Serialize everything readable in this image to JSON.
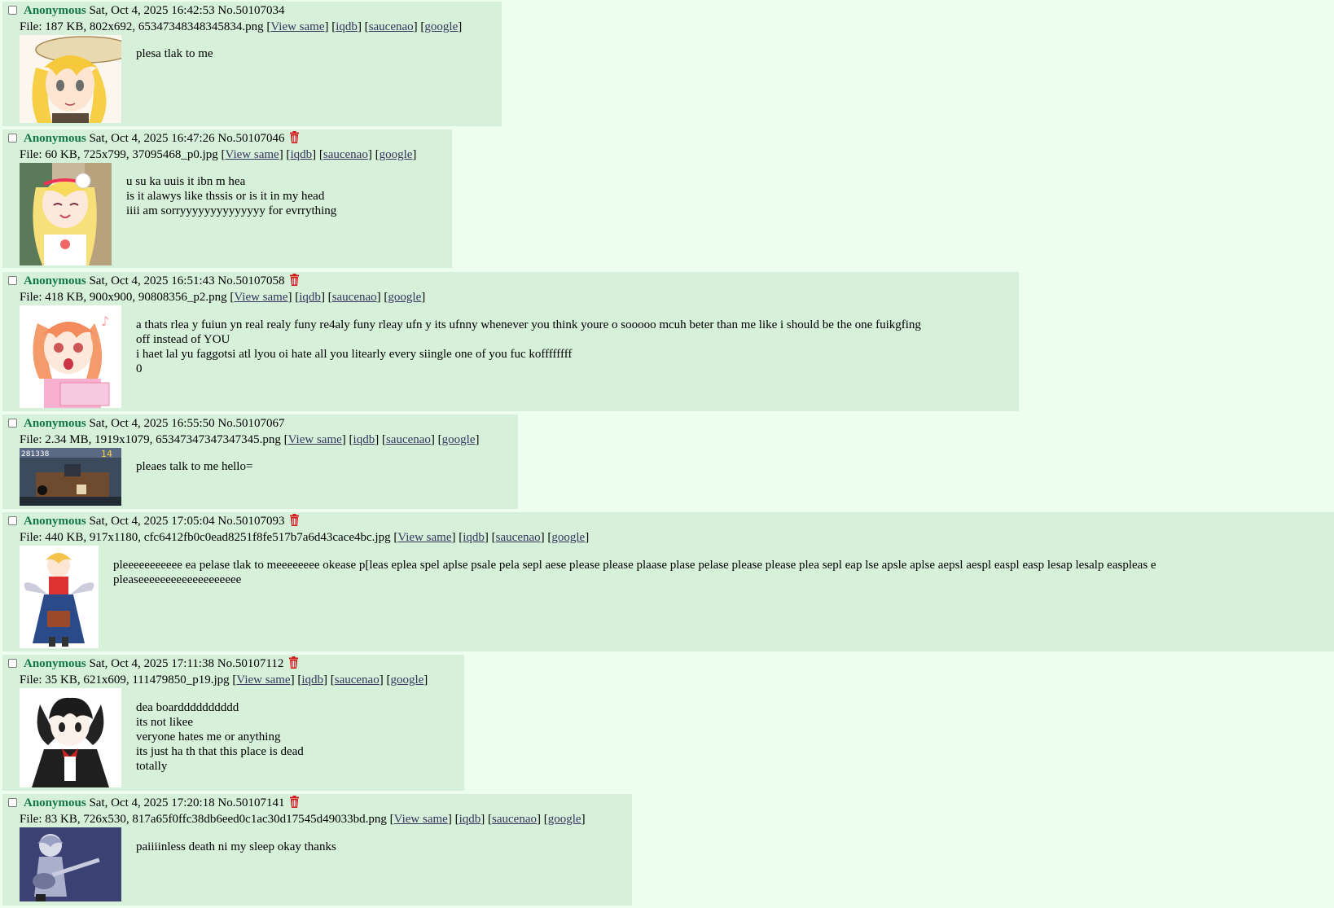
{
  "colors": {
    "page_background": "#eefeee",
    "post_background": "#d6f0da",
    "name": "#117743",
    "link": "#34345c",
    "delete_icon": "#d11b1b"
  },
  "icons": {
    "checkbox": "select-checkbox",
    "delete": "trash-icon"
  },
  "links": {
    "view_same": "View same",
    "iqdb": "iqdb",
    "saucenao": "saucenao",
    "google": "google"
  },
  "posts": [
    {
      "name": "Anonymous",
      "datetime": "Sat, Oct 4, 2025 16:42:53",
      "number": "No.50107034",
      "has_delete": false,
      "file_prefix": "File: 187 KB, 802x692, 65347348348345834.png",
      "body": "plesa tlak to me"
    },
    {
      "name": "Anonymous",
      "datetime": "Sat, Oct 4, 2025 16:47:26",
      "number": "No.50107046",
      "has_delete": true,
      "file_prefix": "File: 60 KB, 725x799, 37095468_p0.jpg",
      "body": "u su ka uuis it ibn m hea\nis it alawys like thssis or is it in my head\niiii am sorryyyyyyyyyyyyyy for evrrything"
    },
    {
      "name": "Anonymous",
      "datetime": "Sat, Oct 4, 2025 16:51:43",
      "number": "No.50107058",
      "has_delete": true,
      "file_prefix": "File: 418 KB, 900x900, 90808356_p2.png",
      "body": "a thats rlea y fuiun yn real realy funy re4aly funy rleay ufn y its ufnny whenever you think youre o sooooo mcuh beter than me like i should be the one fuikgfing\noff instead of YOU\ni haet lal yu faggotsi atl lyou oi hate all you litearly every siingle one of you fuc koffffffff\n0"
    },
    {
      "name": "Anonymous",
      "datetime": "Sat, Oct 4, 2025 16:55:50",
      "number": "No.50107067",
      "has_delete": false,
      "file_prefix": "File: 2.34 MB, 1919x1079, 65347347347347345.png",
      "body": "pleaes talk to me hello="
    },
    {
      "name": "Anonymous",
      "datetime": "Sat, Oct 4, 2025 17:05:04",
      "number": "No.50107093",
      "has_delete": true,
      "file_prefix": "File: 440 KB, 917x1180, cfc6412fb0c0ead8251f8fe517b7a6d43cace4bc.jpg",
      "body": "pleeeeeeeeeee ea pelase tlak to meeeeeeee okease p[leas eplea spel aplse psale pela sepl aese please please plaase plase pelase please please plea sepl eap lse apsle aplse aepsl aespl easpl easp lesap lesalp easpleas e\npleaseeeeeeeeeeeeeeeeeee"
    },
    {
      "name": "Anonymous",
      "datetime": "Sat, Oct 4, 2025 17:11:38",
      "number": "No.50107112",
      "has_delete": true,
      "file_prefix": "File: 35 KB, 621x609, 111479850_p19.jpg",
      "body": "dea boardddddddddd\nits not likee\nveryone hates me or anything\nits just ha th that this place is dead\ntotally"
    },
    {
      "name": "Anonymous",
      "datetime": "Sat, Oct 4, 2025 17:20:18",
      "number": "No.50107141",
      "has_delete": true,
      "file_prefix": "File: 83 KB, 726x530, 817a65f0ffc38db6eed0c1ac30d17545d49033bd.png",
      "body": "paiiiinless death ni my sleep okay thanks"
    }
  ]
}
